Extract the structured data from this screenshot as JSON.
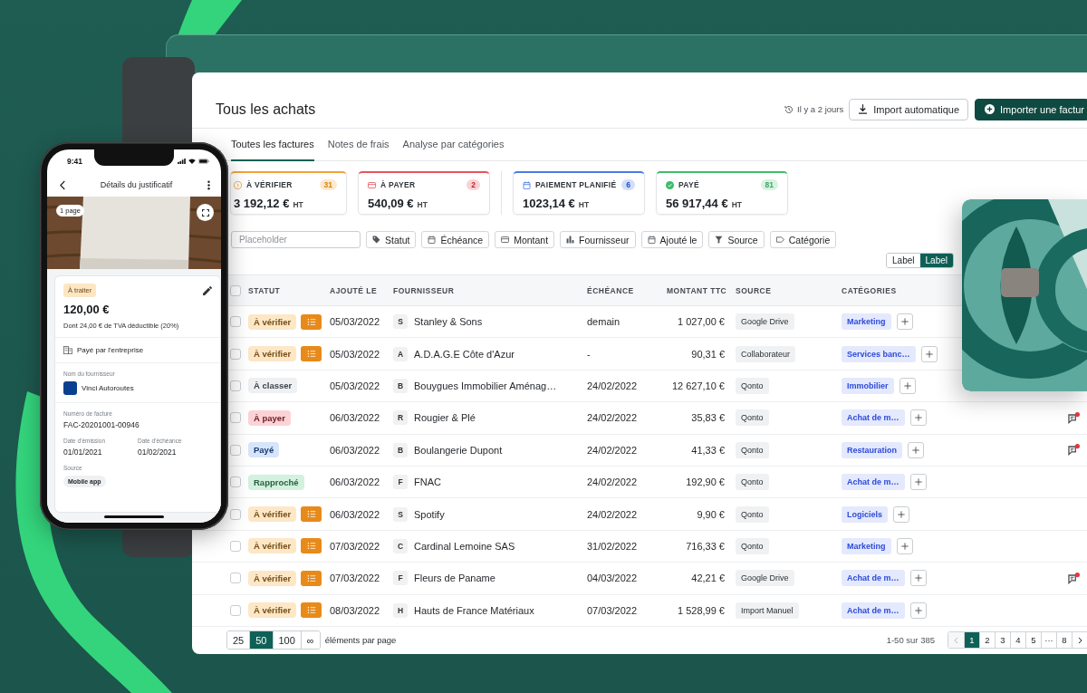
{
  "phone": {
    "time": "9:41",
    "title": "Détails du justificatif",
    "page_count": "1 page",
    "status": "À traiter",
    "amount": "120,00 €",
    "vat_note": "Dont 24,00 € de TVA déductible (20%)",
    "payer": "Payé par l'entreprise",
    "supplier": {
      "label": "Nom du fournisseur",
      "name": "Vinci Autoroutes"
    },
    "invoice": {
      "label": "Numéro de facture",
      "value": "FAC-20201001-00946"
    },
    "dates": [
      {
        "label": "Date d'émission",
        "value": "01/01/2021"
      },
      {
        "label": "Date d'échéance",
        "value": "01/02/2021"
      }
    ],
    "source": {
      "label": "Source",
      "value": "Mobile app"
    }
  },
  "window": {
    "title": "Tous les achats",
    "last_sync": "Il y a 2 jours",
    "buttons": [
      {
        "kind": "secondary",
        "label": "Import automatique"
      },
      {
        "kind": "primary",
        "label": "Importer une factur"
      }
    ],
    "tabs": [
      {
        "label": "Toutes les factures",
        "selected": true
      },
      {
        "label": "Notes de frais",
        "selected": false
      },
      {
        "label": "Analyse par catégories",
        "selected": false
      }
    ],
    "summary_groups": [
      [
        {
          "kind": "review",
          "label": "À VÉRIFIER",
          "count": "31",
          "amount": "3 192,12 €",
          "unit": "HT",
          "color": "#f2a33a"
        },
        {
          "kind": "to_pay",
          "label": "À PAYER",
          "count": "2",
          "amount": "540,09 €",
          "unit": "HT",
          "color": "#e5545c"
        }
      ],
      [
        {
          "kind": "scheduled",
          "label": "PAIEMENT PLANIFIÉ",
          "count": "6",
          "amount": "1023,14 €",
          "unit": "HT",
          "color": "#4a7ae6"
        },
        {
          "kind": "paid",
          "label": "PAYÉ",
          "count": "81",
          "amount": "56 917,44 €",
          "unit": "HT",
          "color": "#3fba6c"
        }
      ]
    ],
    "search": {
      "placeholder": "Placeholder"
    },
    "filters": [
      {
        "kind": "tag",
        "label": "Statut"
      },
      {
        "kind": "calendar",
        "label": "Échéance"
      },
      {
        "kind": "card",
        "label": "Montant"
      },
      {
        "kind": "bars",
        "label": "Fournisseur"
      },
      {
        "kind": "calendar",
        "label": "Ajouté le"
      },
      {
        "kind": "funnel",
        "label": "Source"
      },
      {
        "kind": "label",
        "label": "Catégorie"
      }
    ],
    "view_toggle": [
      {
        "label": "Label",
        "selected": false
      },
      {
        "label": "Label",
        "selected": true
      }
    ],
    "table": {
      "select_all": {
        "checked": false
      },
      "columns": [
        "STATUT",
        "AJOUTÉ LE",
        "FOURNISSEUR",
        "ÉCHÉANCE",
        "MONTANT TTC",
        "SOURCE",
        "CATÉGORIES"
      ],
      "rows": [
        {
          "checked": false,
          "status": {
            "label": "À vérifier",
            "color": "#fde7c7"
          },
          "list_action": true,
          "added": "05/03/2022",
          "supplier_initial": "S",
          "supplier": "Stanley & Sons",
          "due": "demain",
          "amount": "1 027,00 €",
          "source": "Google Drive",
          "category": "Marketing",
          "comment_alert": false
        },
        {
          "checked": false,
          "status": {
            "label": "À vérifier",
            "color": "#fde7c7"
          },
          "list_action": true,
          "added": "05/03/2022",
          "supplier_initial": "A",
          "supplier": "A.D.A.G.E Côte d'Azur",
          "due": "-",
          "amount": "90,31 €",
          "source": "Collaborateur",
          "category": "Services banc…",
          "comment_alert": false
        },
        {
          "checked": false,
          "status": {
            "label": "À classer",
            "color": "#eef0f2"
          },
          "list_action": false,
          "added": "05/03/2022",
          "supplier_initial": "B",
          "supplier": "Bouygues Immobilier Aménag…",
          "due": "24/02/2022",
          "amount": "12 627,10 €",
          "source": "Qonto",
          "category": "Immobilier",
          "comment_alert": false
        },
        {
          "checked": false,
          "status": {
            "label": "À payer",
            "color": "#fbd3d7"
          },
          "list_action": false,
          "added": "06/03/2022",
          "supplier_initial": "R",
          "supplier": "Rougier & Plé",
          "due": "24/02/2022",
          "amount": "35,83 €",
          "source": "Qonto",
          "category": "Achat de m…",
          "comment_alert": true
        },
        {
          "checked": false,
          "status": {
            "label": "Payé",
            "color": "#d7e5fc"
          },
          "list_action": false,
          "added": "06/03/2022",
          "supplier_initial": "B",
          "supplier": "Boulangerie Dupont",
          "due": "24/02/2022",
          "amount": "41,33 €",
          "source": "Qonto",
          "category": "Restauration",
          "comment_alert": true
        },
        {
          "checked": false,
          "status": {
            "label": "Rapproché",
            "color": "#d3f1df"
          },
          "list_action": false,
          "added": "06/03/2022",
          "supplier_initial": "F",
          "supplier": "FNAC",
          "due": "24/02/2022",
          "amount": "192,90 €",
          "source": "Qonto",
          "category": "Achat de m…",
          "comment_alert": false
        },
        {
          "checked": false,
          "status": {
            "label": "À vérifier",
            "color": "#fde7c7"
          },
          "list_action": true,
          "added": "06/03/2022",
          "supplier_initial": "S",
          "supplier": "Spotify",
          "due": "24/02/2022",
          "amount": "9,90 €",
          "source": "Qonto",
          "category": "Logiciels",
          "comment_alert": false
        },
        {
          "checked": false,
          "status": {
            "label": "À vérifier",
            "color": "#fde7c7"
          },
          "list_action": true,
          "added": "07/03/2022",
          "supplier_initial": "C",
          "supplier": "Cardinal Lemoine SAS",
          "due": "31/02/2022",
          "amount": "716,33 €",
          "source": "Qonto",
          "category": "Marketing",
          "comment_alert": false
        },
        {
          "checked": false,
          "status": {
            "label": "À vérifier",
            "color": "#fde7c7"
          },
          "list_action": true,
          "added": "07/03/2022",
          "supplier_initial": "F",
          "supplier": "Fleurs de Paname",
          "due": "04/03/2022",
          "amount": "42,21 €",
          "source": "Google Drive",
          "category": "Achat de m…",
          "comment_alert": true
        },
        {
          "checked": false,
          "status": {
            "label": "À vérifier",
            "color": "#fde7c7"
          },
          "list_action": true,
          "added": "08/03/2022",
          "supplier_initial": "H",
          "supplier": "Hauts de France Matériaux",
          "due": "07/03/2022",
          "amount": "1 528,99 €",
          "source": "Import Manuel",
          "category": "Achat de m…",
          "comment_alert": false
        }
      ]
    },
    "pagination": {
      "page_sizes": [
        {
          "label": "25",
          "selected": false
        },
        {
          "label": "50",
          "selected": true
        },
        {
          "label": "100",
          "selected": false
        },
        {
          "label": "∞",
          "selected": false
        }
      ],
      "page_size_label": "éléments par page",
      "range": "1-50 sur 385",
      "previous_disabled": true,
      "pages": [
        {
          "label": "1",
          "selected": true
        },
        {
          "label": "2",
          "selected": false
        },
        {
          "label": "3",
          "selected": false
        },
        {
          "label": "4",
          "selected": false
        },
        {
          "label": "5",
          "selected": false
        },
        {
          "label": "···",
          "selected": false
        },
        {
          "label": "8",
          "selected": false
        }
      ],
      "next_disabled": false
    }
  }
}
